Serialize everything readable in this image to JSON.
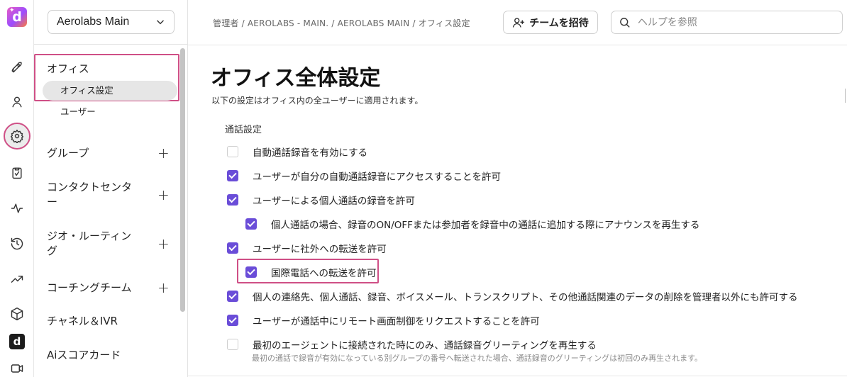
{
  "rail": {
    "icons": [
      "app-logo",
      "rocket-icon",
      "user-icon",
      "gear-icon",
      "clipboard-icon",
      "activity-icon",
      "history-icon",
      "trending-icon",
      "cube-icon",
      "dp-logo",
      "video-icon"
    ],
    "logo_letter": "d",
    "dp_letter": "d"
  },
  "sidebar": {
    "org_select": "Aerolabs Main",
    "office_heading": "オフィス",
    "office_sub_selected": "オフィス設定",
    "office_sub_users": "ユーザー",
    "groups": [
      {
        "label": "グループ",
        "expandable": true
      },
      {
        "label": "コンタクトセンター",
        "expandable": true
      },
      {
        "label": "ジオ・ルーティング",
        "expandable": true
      },
      {
        "label": "コーチングチーム",
        "expandable": true
      },
      {
        "label": "チャネル＆IVR",
        "expandable": false
      },
      {
        "label": "Aiスコアカード",
        "expandable": false
      }
    ]
  },
  "header": {
    "breadcrumb": "管理者 / AEROLABS - MAIN. / AEROLABS MAIN / オフィス設定",
    "invite_label": "チームを招待",
    "search_placeholder": "ヘルプを参照"
  },
  "main": {
    "title": "オフィス全体設定",
    "description": "以下の設定はオフィス内の全ユーザーに適用されます。",
    "section_title": "通話設定",
    "options": [
      {
        "label": "自動通話録音を有効にする",
        "checked": false
      },
      {
        "label": "ユーザーが自分の自動通話録音にアクセスすることを許可",
        "checked": true
      },
      {
        "label": "ユーザーによる個人通話の録音を許可",
        "checked": true
      },
      {
        "label": "個人通話の場合、録音のON/OFFまたは参加者を録音中の通話に追加する際にアナウンスを再生する",
        "checked": true
      },
      {
        "label": "ユーザーに社外への転送を許可",
        "checked": true
      },
      {
        "label": "国際電話への転送を許可",
        "checked": true
      },
      {
        "label": "個人の連絡先、個人通話、録音、ボイスメール、トランスクリプト、その他通話関連のデータの削除を管理者以外にも許可する",
        "checked": true
      },
      {
        "label": "ユーザーが通話中にリモート画面制御をリクエストすることを許可",
        "checked": true
      },
      {
        "label": "最初のエージェントに接続された時にのみ、通話録音グリーティングを再生する",
        "checked": false
      }
    ],
    "last_option_hint": "最初の通話で録音が有効になっている別グループの番号へ転送された場合、通話録音のグリーティングは初回のみ再生されます。"
  },
  "colors": {
    "accent": "#6a4dd8",
    "highlight": "#cf4f86"
  }
}
